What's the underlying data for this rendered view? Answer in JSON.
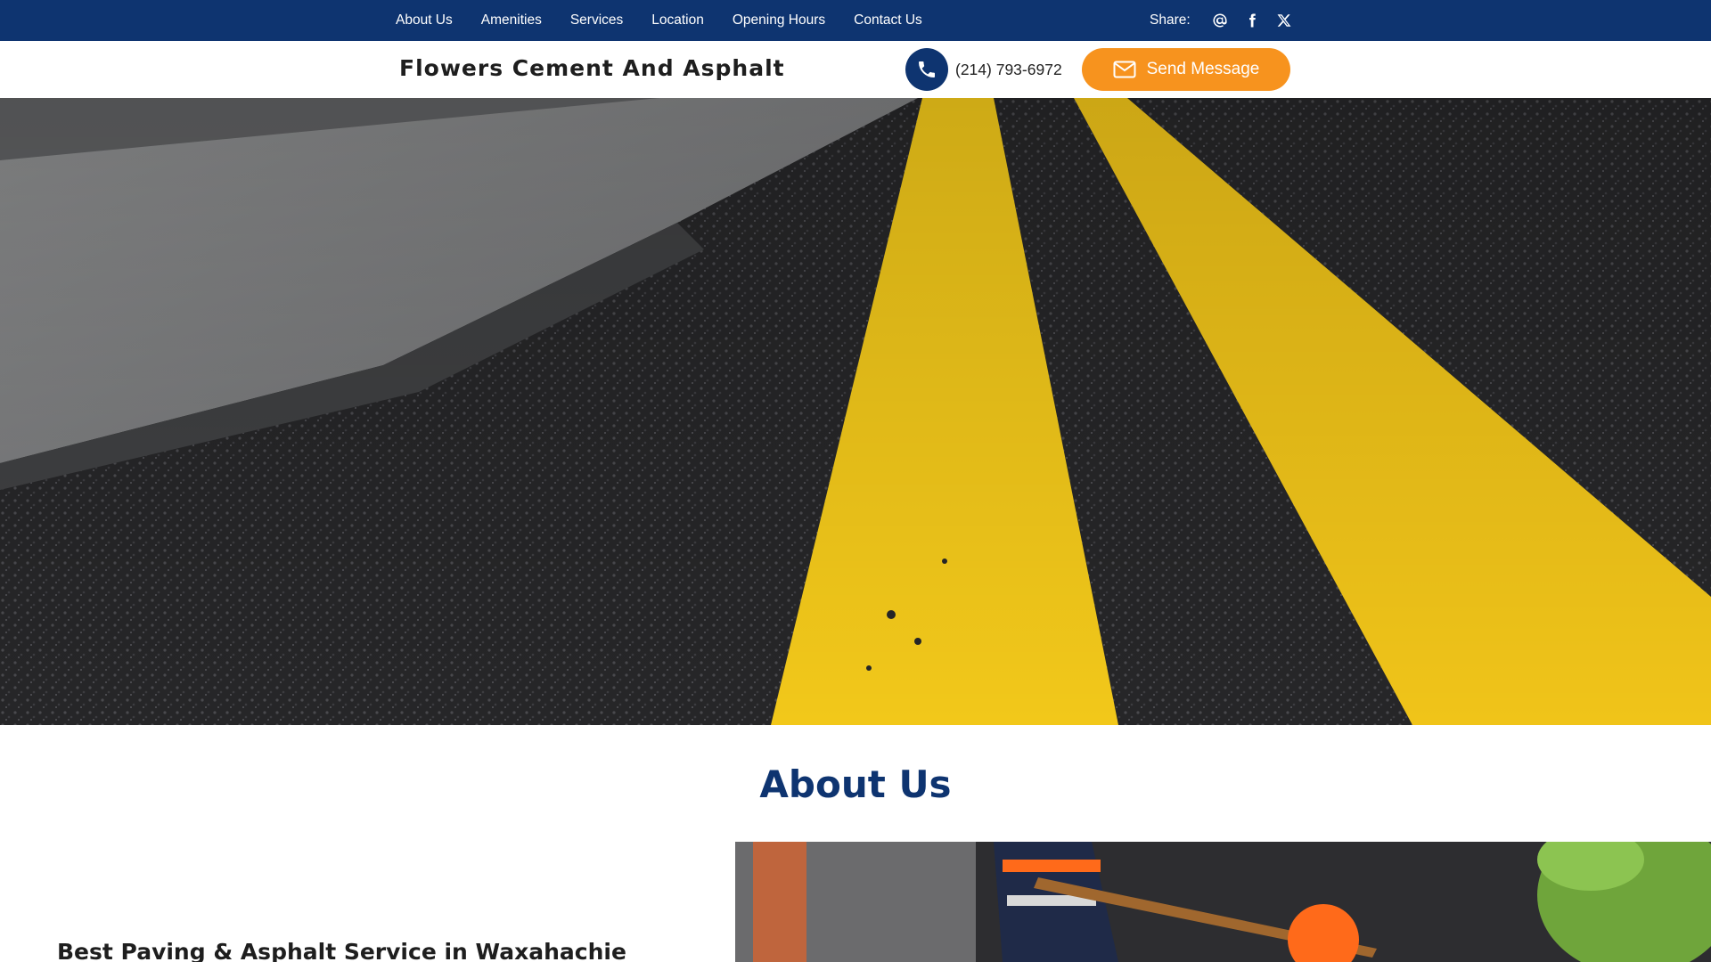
{
  "topnav": {
    "items": [
      "About Us",
      "Amenities",
      "Services",
      "Location",
      "Opening Hours",
      "Contact Us"
    ]
  },
  "share": {
    "label": "Share:",
    "icons": [
      "email-at-icon",
      "facebook-icon",
      "x-twitter-icon"
    ]
  },
  "header": {
    "brand": "Flowers Cement And Asphalt",
    "phone": "(214) 793-6972",
    "send_label": "Send Message"
  },
  "about": {
    "title": "About Us",
    "subtitle": "Best Paving & Asphalt Service in Waxahachie"
  },
  "colors": {
    "navy": "#0e3470",
    "orange": "#f7931e",
    "road_yellow": "#f2c81a"
  }
}
